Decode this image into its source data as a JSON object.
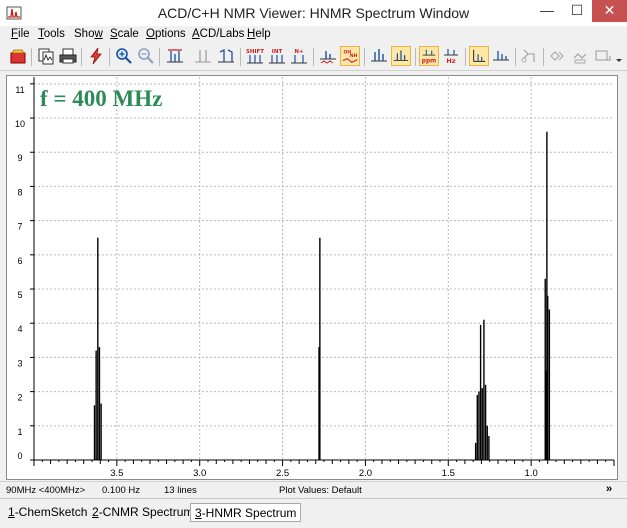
{
  "window": {
    "title": "ACD/C+H NMR Viewer: HNMR Spectrum Window",
    "app_icon": "nmr-app-icon",
    "controls": {
      "minimize": "—",
      "maximize": "☐",
      "close": "✕"
    }
  },
  "menu": [
    {
      "label": "File",
      "key": "F",
      "rest": "ile"
    },
    {
      "label": "Tools",
      "key": "T",
      "rest": "ools"
    },
    {
      "label": "Show",
      "key": "w",
      "pre": "Sho"
    },
    {
      "label": "Scale",
      "key": "S",
      "rest": "cale"
    },
    {
      "label": "Options",
      "key": "O",
      "rest": "ptions"
    },
    {
      "label": "ACD/Labs",
      "key": "A",
      "rest": "CD/Labs"
    },
    {
      "label": "Help",
      "key": "H",
      "rest": "elp"
    }
  ],
  "toolbar": {
    "shift_label": "SHIFT",
    "int_label": "INT",
    "nplus_label": "N+",
    "ohnh_label_1": "OH",
    "ohnh_label_2": "NH",
    "ppm_label": "ppm",
    "hz_label": "Hz"
  },
  "annotation": {
    "frequency_text": "f = 400 MHz"
  },
  "chart_data": {
    "type": "line",
    "x_axis": {
      "range": [
        4.0,
        0.5
      ],
      "reversed": true,
      "tick_labels": [
        "3.5",
        "3.0",
        "2.5",
        "2.0",
        "1.5",
        "1.0"
      ],
      "tick_values": [
        3.5,
        3.0,
        2.5,
        2.0,
        1.5,
        1.0
      ]
    },
    "y_axis": {
      "range": [
        0,
        11.2
      ],
      "tick_labels": [
        "0",
        "1",
        "2",
        "3",
        "4",
        "5",
        "6",
        "7",
        "8",
        "9",
        "10",
        "11"
      ],
      "tick_values": [
        0,
        1,
        2,
        3,
        4,
        5,
        6,
        7,
        8,
        9,
        10,
        11
      ]
    },
    "grid": true,
    "peaks": [
      {
        "x": 3.635,
        "y": 1.6
      },
      {
        "x": 3.625,
        "y": 3.2
      },
      {
        "x": 3.615,
        "y": 6.5
      },
      {
        "x": 3.605,
        "y": 3.3
      },
      {
        "x": 3.595,
        "y": 1.65
      },
      {
        "x": 2.28,
        "y": 3.3
      },
      {
        "x": 2.275,
        "y": 6.5
      },
      {
        "x": 1.335,
        "y": 0.5
      },
      {
        "x": 1.325,
        "y": 1.9
      },
      {
        "x": 1.315,
        "y": 2.0
      },
      {
        "x": 1.305,
        "y": 3.95
      },
      {
        "x": 1.295,
        "y": 2.1
      },
      {
        "x": 1.285,
        "y": 4.1
      },
      {
        "x": 1.275,
        "y": 2.2
      },
      {
        "x": 1.265,
        "y": 1.0
      },
      {
        "x": 1.255,
        "y": 0.7
      },
      {
        "x": 0.915,
        "y": 5.3
      },
      {
        "x": 0.91,
        "y": 2.6
      },
      {
        "x": 0.905,
        "y": 9.6
      },
      {
        "x": 0.9,
        "y": 4.8
      },
      {
        "x": 0.89,
        "y": 4.4
      }
    ]
  },
  "status": {
    "spectrometer": "90MHz <400MHz>",
    "resolution": "0.100 Hz",
    "lines": "13 lines",
    "plot_values": "Plot Values: Default",
    "more": "»"
  },
  "tabs": [
    {
      "num": "1",
      "label": "-ChemSketch",
      "active": false
    },
    {
      "num": "2",
      "label": "-CNMR Spectrum",
      "active": false
    },
    {
      "num": "3",
      "label": "-HNMR Spectrum",
      "active": true
    }
  ]
}
